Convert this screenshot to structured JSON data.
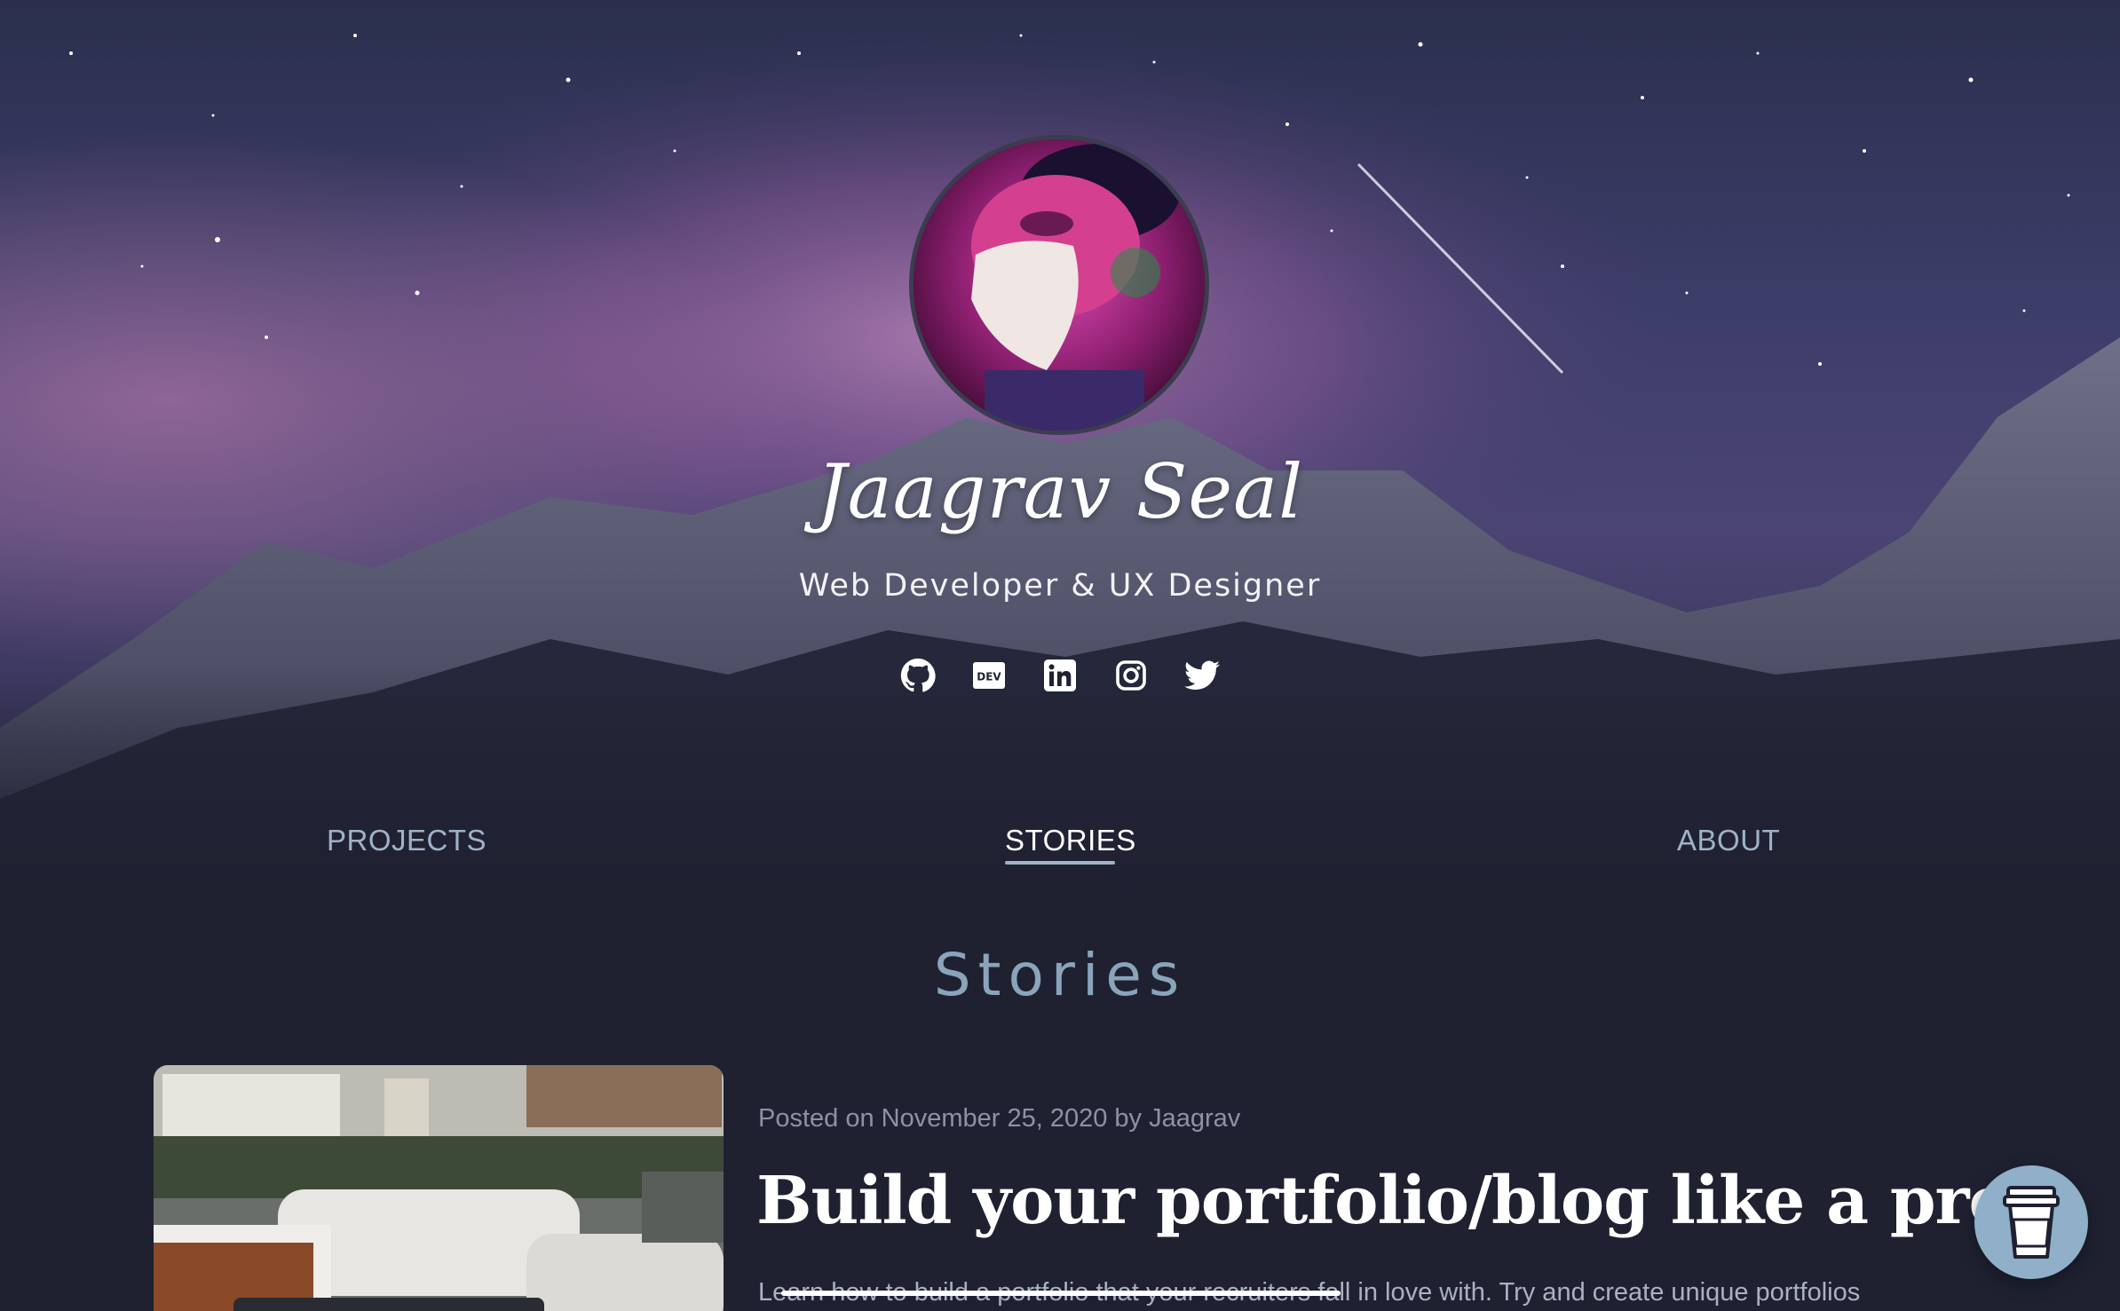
{
  "hero": {
    "name": "Jaagrav Seal",
    "subtitle": "Web Developer & UX Designer",
    "socials": [
      {
        "icon": "github-icon",
        "label": "GitHub"
      },
      {
        "icon": "dev-icon",
        "label": "DEV"
      },
      {
        "icon": "linkedin-icon",
        "label": "LinkedIn"
      },
      {
        "icon": "instagram-icon",
        "label": "Instagram"
      },
      {
        "icon": "twitter-icon",
        "label": "Twitter"
      }
    ]
  },
  "nav": {
    "projects": "PROJECTS",
    "stories": "STORIES",
    "about": "ABOUT",
    "active": "STORIES"
  },
  "section": {
    "title": "Stories"
  },
  "post": {
    "meta": "Posted on November 25, 2020 by Jaagrav",
    "title": "Build your portfolio/blog like a pro!!",
    "excerpt": "Learn how to build a portfolio that your recruiters fall in love with. Try and create unique portfolios"
  },
  "floating": {
    "icon": "coffee-cup-icon"
  },
  "colors": {
    "background": "#1f2131",
    "accent": "#9fb3c8",
    "title": "#8aa4bb",
    "button": "#8fb0c8"
  }
}
